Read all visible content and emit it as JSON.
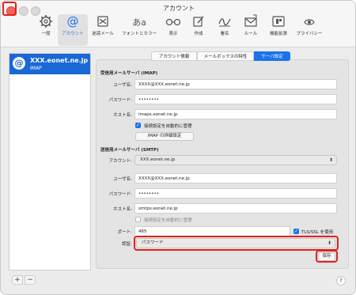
{
  "window": {
    "title": "アカウント"
  },
  "toolbar": {
    "items": [
      {
        "label": "一般",
        "icon": "gear-icon"
      },
      {
        "label": "アカウント",
        "icon": "at-icon"
      },
      {
        "label": "迷惑メール",
        "icon": "junk-icon"
      },
      {
        "label": "フォントとカラー",
        "icon": "fonts-icon"
      },
      {
        "label": "表示",
        "icon": "glasses-icon"
      },
      {
        "label": "作成",
        "icon": "compose-icon"
      },
      {
        "label": "署名",
        "icon": "signature-icon"
      },
      {
        "label": "ルール",
        "icon": "rules-icon"
      },
      {
        "label": "機能拡張",
        "icon": "extensions-icon"
      },
      {
        "label": "プライバシー",
        "icon": "privacy-icon"
      }
    ]
  },
  "sidebar": {
    "account_name": "XXX.eonet.ne.jp",
    "account_type": "IMAP",
    "add_label": "+",
    "remove_label": "−"
  },
  "tabs": [
    "アカウント情報",
    "メールボックスの特性",
    "サーバ設定"
  ],
  "imap": {
    "heading": "受信用メールサーバ (IMAP)",
    "username_label": "ユーザ名:",
    "username_value": "XXXX@XXX.eonet.ne.jp",
    "password_label": "パスワード:",
    "password_value": "••••••••",
    "host_label": "ホスト名:",
    "host_value": "imaps.eonet.ne.jp",
    "auto_manage_label": "接続設定を自動的に管理",
    "advanced_button": "IMAP の詳細設定"
  },
  "smtp": {
    "heading": "送信用メールサーバ (SMTP)",
    "account_label": "アカウント:",
    "account_value": "XXX.eonet.ne.jp",
    "username_label": "ユーザ名:",
    "username_value": "XXXX@XXX.eonet.ne.jp",
    "password_label": "パスワード:",
    "password_value": "••••••••",
    "host_label": "ホスト名:",
    "host_value": "smtps.eonet.ne.jp",
    "auto_manage_label": "接続設定を自動的に管理",
    "port_label": "ポート:",
    "port_value": "465",
    "tls_label": "TLS/SSL を使用",
    "auth_label": "認証:",
    "auth_value": "パスワード",
    "save_button": "保存"
  },
  "help_label": "?",
  "colors": {
    "accent": "#1a73e8",
    "highlight": "#e2211c"
  }
}
